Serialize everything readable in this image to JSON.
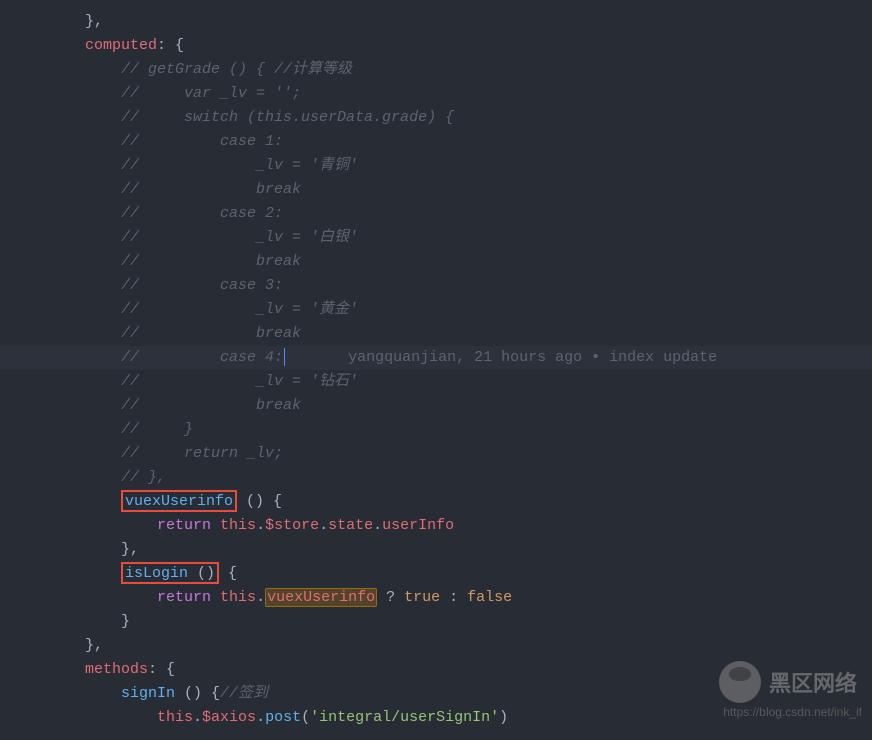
{
  "code": {
    "close_brace_comma": "},",
    "computed_key": "computed",
    "colon_space_brace": ": {",
    "comment_lines": [
      "// getGrade () { //计算等级",
      "//     var _lv = '';",
      "//     switch (this.userData.grade) {",
      "//         case 1:",
      "//             _lv = '青铜'",
      "//             break",
      "//         case 2:",
      "//             _lv = '白银'",
      "//             break",
      "//         case 3:",
      "//             _lv = '黄金'",
      "//             break",
      "//         case 4:",
      "//             _lv = '钻石'",
      "//             break",
      "//     }",
      "//     return _lv;",
      "// },"
    ],
    "vuex_method": "vuexUserinfo",
    "vuex_sig": " () {",
    "return_kw": "return",
    "this_kw": "this",
    "dot": ".",
    "store_chain": "$store",
    "state_prop": "state",
    "userInfo_prop": "userInfo",
    "close_brace": "}",
    "close_brace_comma2": "},",
    "isLogin_method": "isLogin",
    "isLogin_sig": " () {",
    "vuex_ref": "vuexUserinfo",
    "ternary_q": " ? ",
    "true_val": "true",
    "ternary_colon": " : ",
    "false_val": "false",
    "methods_key": "methods",
    "signIn_method": "signIn",
    "signIn_sig": " () {",
    "signIn_comment": "//签到",
    "axios_prop": "$axios",
    "post_method": "post",
    "post_arg": "'integral/userSignIn'",
    "paren_close": ")"
  },
  "blame": {
    "author": "yangquanjian",
    "time": "21 hours ago",
    "sep": " • ",
    "msg": "index update"
  },
  "watermark": {
    "text": "黑区网络",
    "url": "https://blog.csdn.net/ink_if"
  }
}
